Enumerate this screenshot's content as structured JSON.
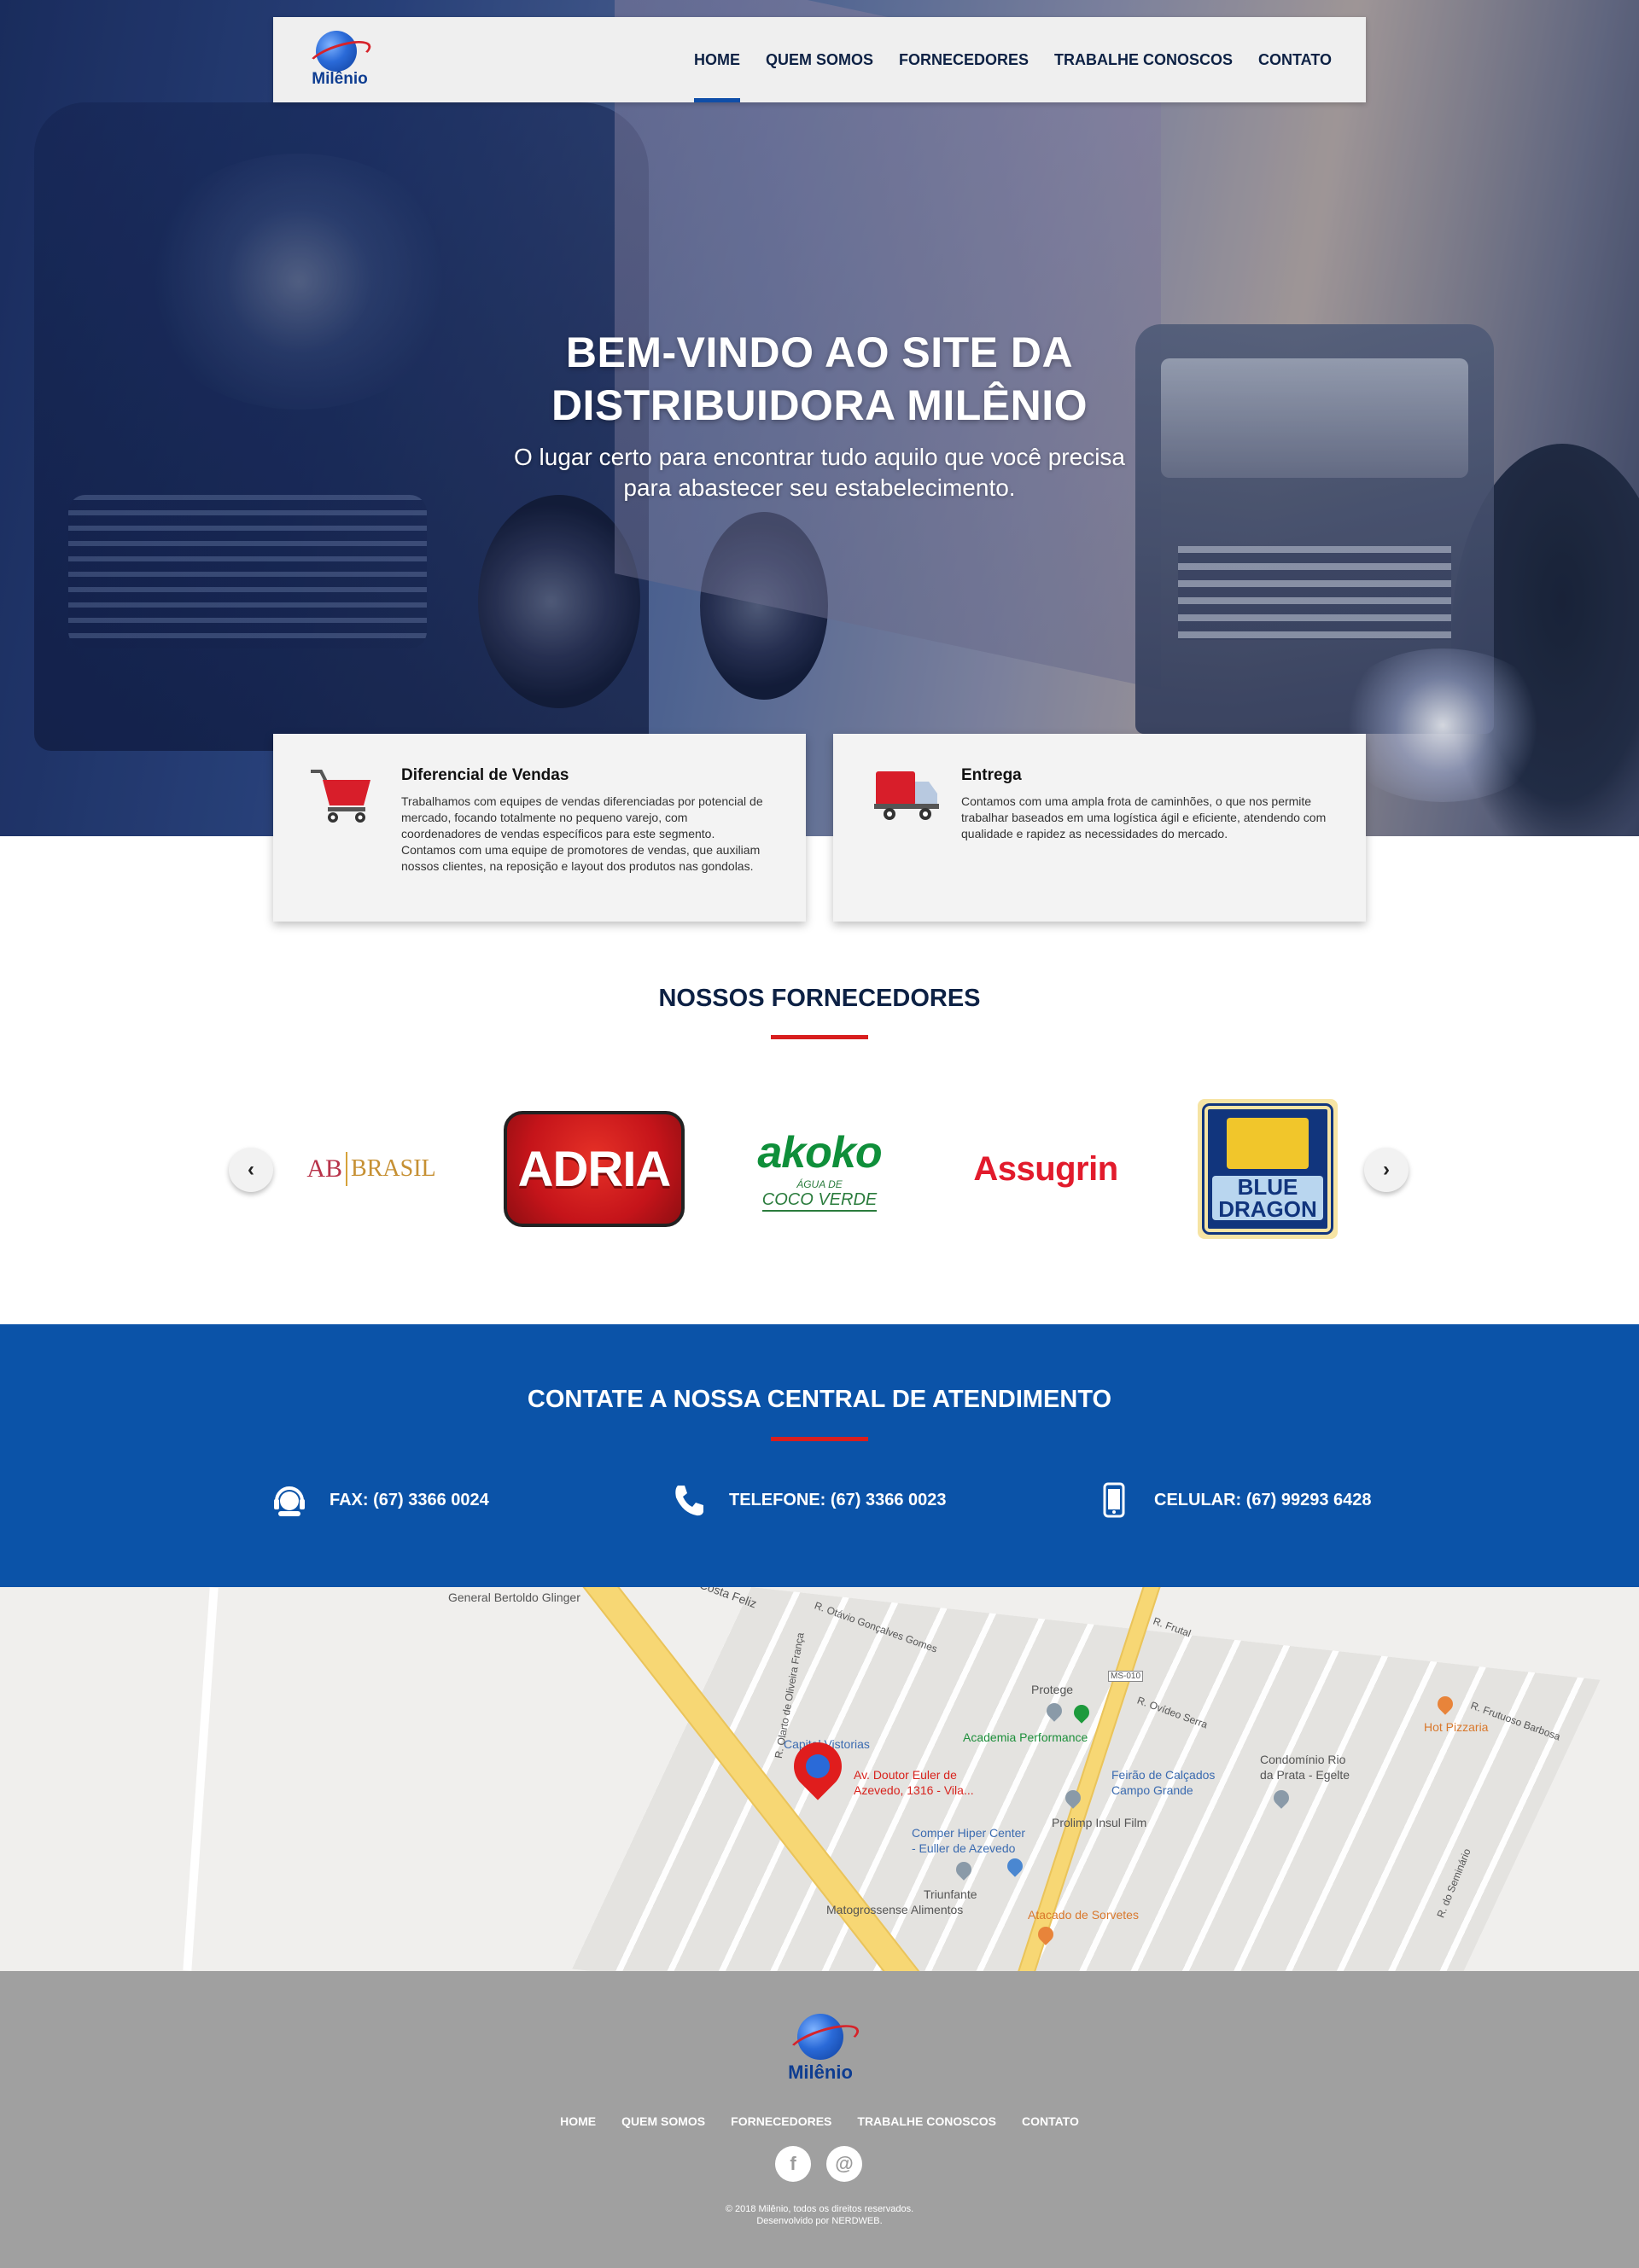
{
  "brand": {
    "name": "Milênio"
  },
  "nav": {
    "items": [
      {
        "label": "HOME",
        "active": true
      },
      {
        "label": "QUEM SOMOS",
        "active": false
      },
      {
        "label": "FORNECEDORES",
        "active": false
      },
      {
        "label": "TRABALHE CONOSCOS",
        "active": false
      },
      {
        "label": "CONTATO",
        "active": false
      }
    ]
  },
  "hero": {
    "title_line1": "BEM-VINDO AO SITE DA",
    "title_line2": "DISTRIBUIDORA MILÊNIO",
    "subtitle_line1": "O lugar certo para encontrar tudo aquilo que você precisa",
    "subtitle_line2": "para abastecer seu estabelecimento."
  },
  "features": [
    {
      "icon": "shopping-cart-icon",
      "title": "Diferencial de Vendas",
      "text": "Trabalhamos com equipes de vendas diferenciadas por potencial de mercado, focando totalmente no pequeno varejo, com coordenadores de vendas específicos para este segmento. Contamos com uma equipe de promotores de vendas, que auxiliam nossos clientes, na reposição e layout dos produtos nas gondolas."
    },
    {
      "icon": "delivery-truck-icon",
      "title": "Entrega",
      "text": "Contamos com uma ampla frota de caminhões, o que nos permite trabalhar baseados em uma logística ágil e eficiente, atendendo com qualidade e rapidez as necessidades do mercado."
    }
  ],
  "suppliers": {
    "title": "NOSSOS FORNECEDORES",
    "prev": "‹",
    "next": "›",
    "logos": {
      "ab_brasil_a": "AB",
      "ab_brasil_b": "BRASIL",
      "adria": "ADRIA",
      "akoko": "akoko",
      "akoko_sub1": "ÁGUA DE",
      "akoko_sub2": "COCO VERDE",
      "assugrin": "Assugrin",
      "blue_dragon": "BLUE DRAGON"
    }
  },
  "contact": {
    "title": "CONTATE A NOSSA CENTRAL DE ATENDIMENTO",
    "items": [
      {
        "icon": "headset-icon",
        "label": "FAX: (67) 3366 0024"
      },
      {
        "icon": "phone-icon",
        "label": "TELEFONE: (67) 3366 0023"
      },
      {
        "icon": "mobile-phone-icon",
        "label": "CELULAR: (67) 99293 6428"
      }
    ]
  },
  "map": {
    "labels": {
      "general": "General Bertoldo Glinger",
      "costa": "Costa Feliz",
      "otavio": "R. Otávio Gonçalves Gomes",
      "olarto": "R. Olarto de Oliveira França",
      "frutal": "R. Frutal",
      "protege": "Protege",
      "capital": "Capital Vistorias",
      "academia": "Academia Performance",
      "address1": "Av. Doutor Euler de",
      "address2": "Azevedo, 1316 - Vila...",
      "feirao1": "Feirão de Calçados",
      "feirao2": "Campo Grande",
      "prolimp": "Prolimp Insul Film",
      "comper1": "Comper Hiper Center",
      "comper2": "- Euller de Azevedo",
      "triunfante": "Triunfante",
      "matogrossense": "Matogrossense Alimentos",
      "atacado": "Atacado de Sorvetes",
      "hot": "Hot Pizzaria",
      "condominio1": "Condomínio Rio",
      "condominio2": "da Prata - Egelte",
      "ovideo": "R. Ovídeo Serra",
      "frutuoso": "R. Frutuoso Barbosa",
      "ms": "MS-010",
      "seminario": "R. do Seminário"
    }
  },
  "footer": {
    "menu": [
      "HOME",
      "QUEM SOMOS",
      "FORNECEDORES",
      "TRABALHE CONOSCOS",
      "CONTATO"
    ],
    "social": [
      {
        "icon": "facebook-icon",
        "glyph": "f"
      },
      {
        "icon": "email-at-icon",
        "glyph": "@"
      }
    ],
    "copyright": "© 2018 Milênio, todos os direitos reservados.",
    "credit": "Desenvolvido por NERDWEB."
  }
}
